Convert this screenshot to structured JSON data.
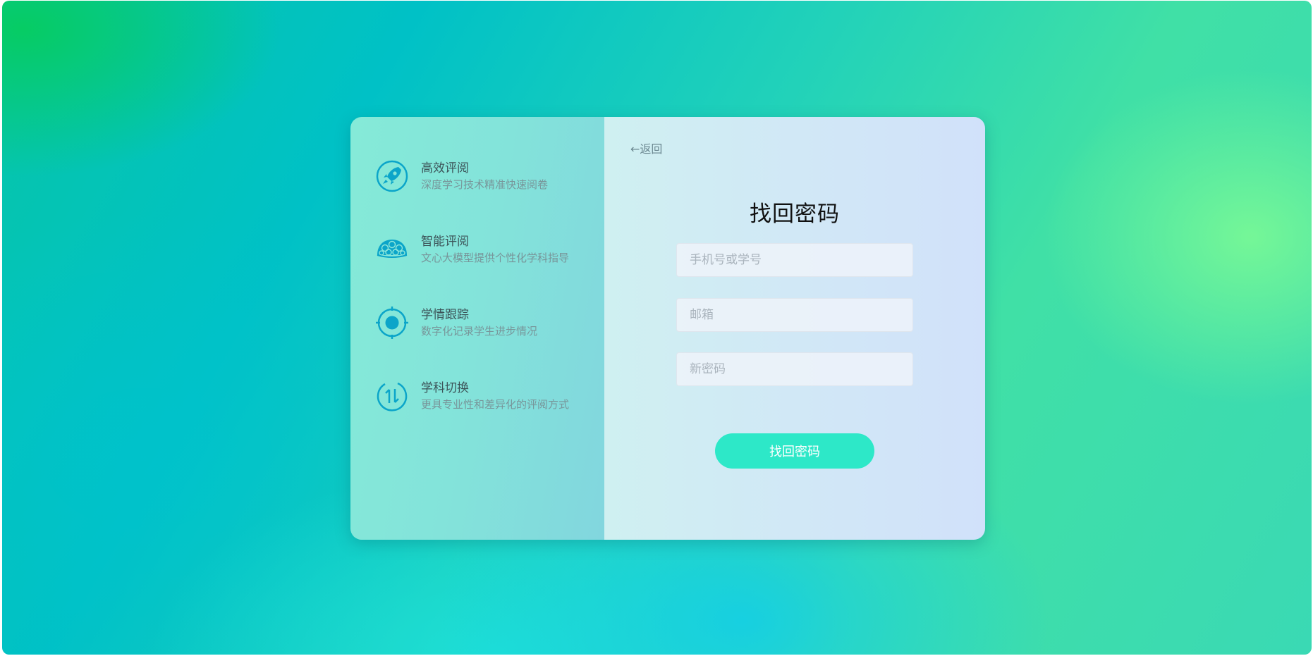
{
  "colors": {
    "accent": "#2de8c8",
    "icon": "#0ba5c9",
    "title_text": "#111111"
  },
  "features": [
    {
      "icon": "rocket-icon",
      "title": "高效评阅",
      "desc": "深度学习技术精准快速阅卷"
    },
    {
      "icon": "brain-icon",
      "title": "智能评阅",
      "desc": "文心大模型提供个性化学科指导"
    },
    {
      "icon": "target-icon",
      "title": "学情跟踪",
      "desc": "数字化记录学生进步情况"
    },
    {
      "icon": "switch-icon",
      "title": "学科切换",
      "desc": "更具专业性和差异化的评阅方式"
    }
  ],
  "form": {
    "back_label": "←返回",
    "title": "找回密码",
    "phone_placeholder": "手机号或学号",
    "email_placeholder": "邮箱",
    "password_placeholder": "新密码",
    "submit_label": "找回密码"
  }
}
